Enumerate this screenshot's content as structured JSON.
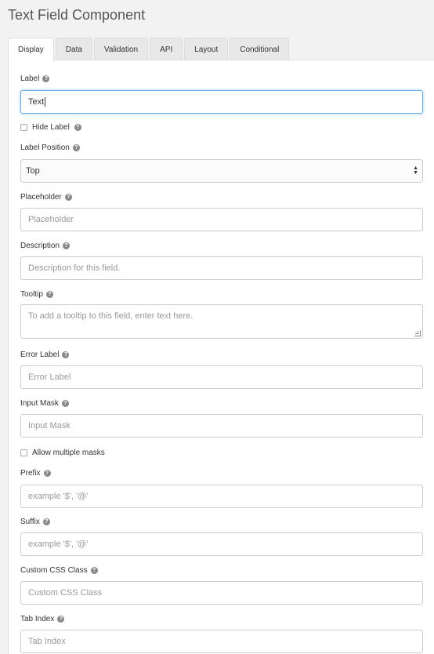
{
  "title": "Text Field Component",
  "tabs": [
    {
      "label": "Display"
    },
    {
      "label": "Data"
    },
    {
      "label": "Validation"
    },
    {
      "label": "API"
    },
    {
      "label": "Layout"
    },
    {
      "label": "Conditional"
    }
  ],
  "fields": {
    "label": {
      "label": "Label",
      "value": "Text"
    },
    "hide_label": {
      "label": "Hide Label"
    },
    "label_position": {
      "label": "Label Position",
      "value": "Top"
    },
    "placeholder": {
      "label": "Placeholder",
      "placeholder": "Placeholder"
    },
    "description": {
      "label": "Description",
      "placeholder": "Description for this field."
    },
    "tooltip": {
      "label": "Tooltip",
      "placeholder": "To add a tooltip to this field, enter text here."
    },
    "error_label": {
      "label": "Error Label",
      "placeholder": "Error Label"
    },
    "input_mask": {
      "label": "Input Mask",
      "placeholder": "Input Mask"
    },
    "allow_multiple_masks": {
      "label": "Allow multiple masks"
    },
    "prefix": {
      "label": "Prefix",
      "placeholder": "example '$', '@'"
    },
    "suffix": {
      "label": "Suffix",
      "placeholder": "example '$', '@'"
    },
    "custom_css": {
      "label": "Custom CSS Class",
      "placeholder": "Custom CSS Class"
    },
    "tab_index": {
      "label": "Tab Index",
      "placeholder": "Tab Index"
    }
  },
  "icons": {
    "help": "question-circle-icon"
  }
}
